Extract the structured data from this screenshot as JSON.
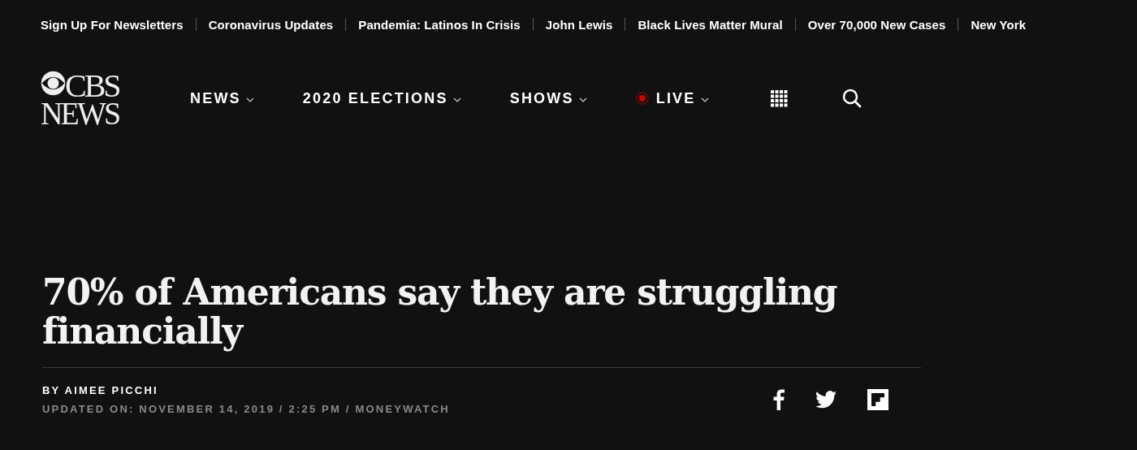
{
  "trending": [
    "Sign Up For Newsletters",
    "Coronavirus Updates",
    "Pandemia: Latinos In Crisis",
    "John Lewis",
    "Black Lives Matter Mural",
    "Over 70,000 New Cases",
    "New York"
  ],
  "logo": {
    "line_1": "CBS",
    "line_2": "NEWS"
  },
  "nav": [
    {
      "label": "NEWS",
      "kind": "menu"
    },
    {
      "label": "2020 ELECTIONS",
      "kind": "menu"
    },
    {
      "label": "SHOWS",
      "kind": "menu"
    },
    {
      "label": "LIVE",
      "kind": "live"
    }
  ],
  "article": {
    "headline": "70% of Americans say they are struggling financially",
    "byline": "BY AIMEE PICCHI",
    "meta": "UPDATED ON: NOVEMBER 14, 2019 / 2:25 PM / MONEYWATCH"
  }
}
